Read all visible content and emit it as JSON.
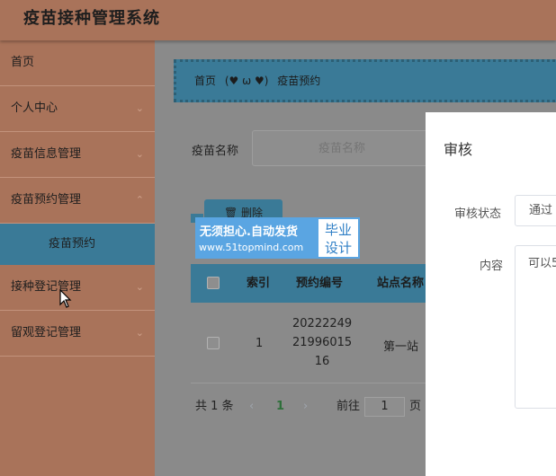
{
  "app": {
    "title": "疫苗接种管理系统"
  },
  "sidebar": {
    "items": [
      {
        "label": "首页",
        "has_arrow": false
      },
      {
        "label": "个人中心",
        "has_arrow": true
      },
      {
        "label": "疫苗信息管理",
        "has_arrow": true
      },
      {
        "label": "疫苗预约管理",
        "has_arrow": true
      },
      {
        "label": "接种登记管理",
        "has_arrow": true
      },
      {
        "label": "留观登记管理",
        "has_arrow": true
      }
    ],
    "active_sub": "疫苗预约"
  },
  "breadcrumb": {
    "home": "首页",
    "emoji": "(♥ ω ♥)",
    "current": "疫苗预约"
  },
  "search": {
    "label": "疫苗名称",
    "placeholder": "疫苗名称"
  },
  "toolbar": {
    "delete_label": "删除"
  },
  "table": {
    "headers": [
      "索引",
      "预约编号",
      "站点名称"
    ],
    "rows": [
      {
        "index": "1",
        "code_lines": [
          "20222249",
          "21996015",
          "16"
        ],
        "site": "第一站"
      }
    ]
  },
  "pager": {
    "total": "共 1 条",
    "prev": "‹",
    "page": "1",
    "next": "›",
    "goto_label": "前往",
    "goto_value": "1",
    "page_suffix": "页"
  },
  "dialog": {
    "title": "审核",
    "status_label": "审核状态",
    "status_value": "通过",
    "content_label": "内容",
    "content_value": "可以5"
  },
  "watermark": {
    "line1": "无须担心.自动发货",
    "line2": "www.51topmind.com",
    "badge_line1": "毕业",
    "badge_line2": "设计"
  },
  "colors": {
    "topbar": "#a9735a",
    "accent": "#3a7a97",
    "overlay": "#8a8a8a"
  }
}
